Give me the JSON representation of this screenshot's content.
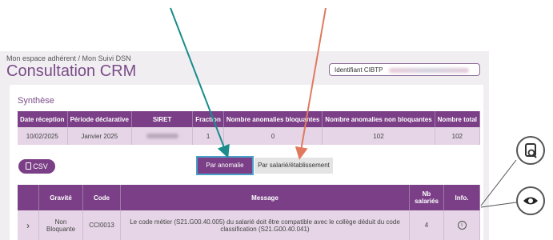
{
  "breadcrumb": "Mon espace adhérent / Mon Suivi DSN",
  "page_title": "Consultation CRM",
  "identifier_label": "Identifiant CIBTP",
  "synthese": {
    "title": "Synthèse",
    "columns": [
      "Date réception",
      "Période déclarative",
      "SIRET",
      "Fraction",
      "Nombre anomalies bloquantes",
      "Nombre anomalies non bloquantes",
      "Nombre total"
    ],
    "row": {
      "date": "10/02/2025",
      "periode": "Janvier 2025",
      "fraction": "1",
      "bloquantes": "0",
      "non_bloquantes": "102",
      "total": "102"
    }
  },
  "csv_label": "CSV",
  "tabs": {
    "by_anomaly": "Par anomalie",
    "by_employee": "Par salarié/établissement"
  },
  "detail": {
    "columns": {
      "gravite": "Gravité",
      "code": "Code",
      "message": "Message",
      "nb": "Nb salariés",
      "info": "Info."
    },
    "row": {
      "gravite": "Non Bloquante",
      "code": "CCI0013",
      "message": "Le code métier (S21.G00.40.005) du salarié doit être compatible avec le collège déduit du code classification (S21.G00.40.041)",
      "nb": "4"
    }
  },
  "colors": {
    "brand": "#7a3f86",
    "arrow_teal": "#1a8c8c",
    "arrow_salmon": "#e07a5f",
    "highlight": "#4aa0c8"
  },
  "icons": {
    "expand": "chevron-right-icon",
    "info": "info-circle-icon",
    "doc": "document-search-icon",
    "eye": "eye-icon",
    "file": "file-icon"
  }
}
